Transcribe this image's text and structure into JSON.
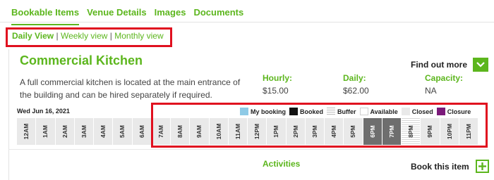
{
  "tabs": [
    {
      "label": "Bookable Items"
    },
    {
      "label": "Venue Details"
    },
    {
      "label": "Images"
    },
    {
      "label": "Documents"
    }
  ],
  "view_switch": {
    "daily": "Daily View",
    "separator": "|",
    "weekly": "Weekly view",
    "monthly": "Monthly view"
  },
  "item": {
    "title": "Commercial Kitchen",
    "description": "A full commercial kitchen is located at the main entrance of the building and can be hired separately if required."
  },
  "rates": {
    "hourly_label": "Hourly:",
    "hourly_value": "$15.00",
    "daily_label": "Daily:",
    "daily_value": "$62.00",
    "capacity_label": "Capacity:",
    "capacity_value": "NA"
  },
  "find_out_more": {
    "label": "Find out more",
    "icon": "chevron-down-icon"
  },
  "date": "Wed Jun 16, 2021",
  "legend": [
    {
      "label": "My booking",
      "color": "#8ecae6"
    },
    {
      "label": "Booked",
      "color": "#111111"
    },
    {
      "label": "Buffer",
      "color": "#c8c8c8"
    },
    {
      "label": "Available",
      "color": "#ffffff"
    },
    {
      "label": "Closed",
      "color": "#e9e9e9"
    },
    {
      "label": "Closure",
      "color": "#7b1a7a"
    }
  ],
  "timeline": {
    "slots": [
      {
        "label": "12AM",
        "status": "available"
      },
      {
        "label": "1AM",
        "status": "available"
      },
      {
        "label": "2AM",
        "status": "available"
      },
      {
        "label": "3AM",
        "status": "available"
      },
      {
        "label": "4AM",
        "status": "available"
      },
      {
        "label": "5AM",
        "status": "available"
      },
      {
        "label": "6AM",
        "status": "available"
      },
      {
        "label": "7AM",
        "status": "available"
      },
      {
        "label": "8AM",
        "status": "available"
      },
      {
        "label": "9AM",
        "status": "available"
      },
      {
        "label": "10AM",
        "status": "available"
      },
      {
        "label": "11AM",
        "status": "available"
      },
      {
        "label": "12PM",
        "status": "available"
      },
      {
        "label": "1PM",
        "status": "available"
      },
      {
        "label": "2PM",
        "status": "available"
      },
      {
        "label": "3PM",
        "status": "available"
      },
      {
        "label": "4PM",
        "status": "available"
      },
      {
        "label": "5PM",
        "status": "available"
      },
      {
        "label": "6PM",
        "status": "booked"
      },
      {
        "label": "7PM",
        "status": "booked"
      },
      {
        "label": "8PM",
        "status": "buffer"
      },
      {
        "label": "9PM",
        "status": "available"
      },
      {
        "label": "10PM",
        "status": "available"
      },
      {
        "label": "11PM",
        "status": "available"
      }
    ]
  },
  "activities_label": "Activities",
  "book": {
    "label": "Book this item",
    "icon": "plus-icon"
  },
  "colors": {
    "accent": "#5cb61d",
    "highlight": "#e0101f",
    "booked": "#6e6e6e"
  }
}
